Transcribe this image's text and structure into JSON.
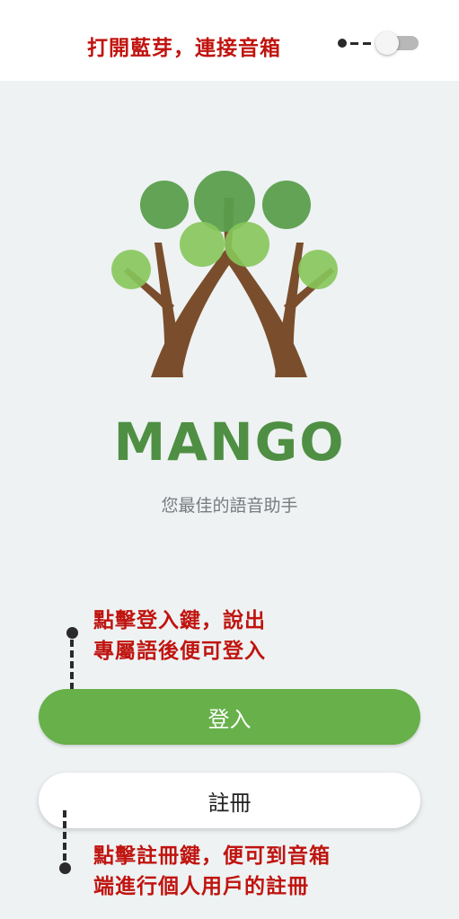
{
  "bluetooth": {
    "hint": "打開藍芽，連接音箱",
    "toggle_state": "off"
  },
  "brand": {
    "name": "MANGO",
    "tagline": "您最佳的語音助手",
    "colors": {
      "leaf_dark": "#5a9e4d",
      "leaf_light": "#86c65a",
      "trunk": "#7a4e2c",
      "wordmark": "#4f8f43",
      "button": "#67b04a",
      "hint_red": "#c0140f"
    }
  },
  "login": {
    "hint_line1": "點擊登入鍵，說出",
    "hint_line2": "專屬語後便可登入",
    "button_label": "登入"
  },
  "register": {
    "button_label": "註冊",
    "hint_line1": "點擊註冊鍵，便可到音箱",
    "hint_line2": "端進行個人用戶的註冊"
  }
}
